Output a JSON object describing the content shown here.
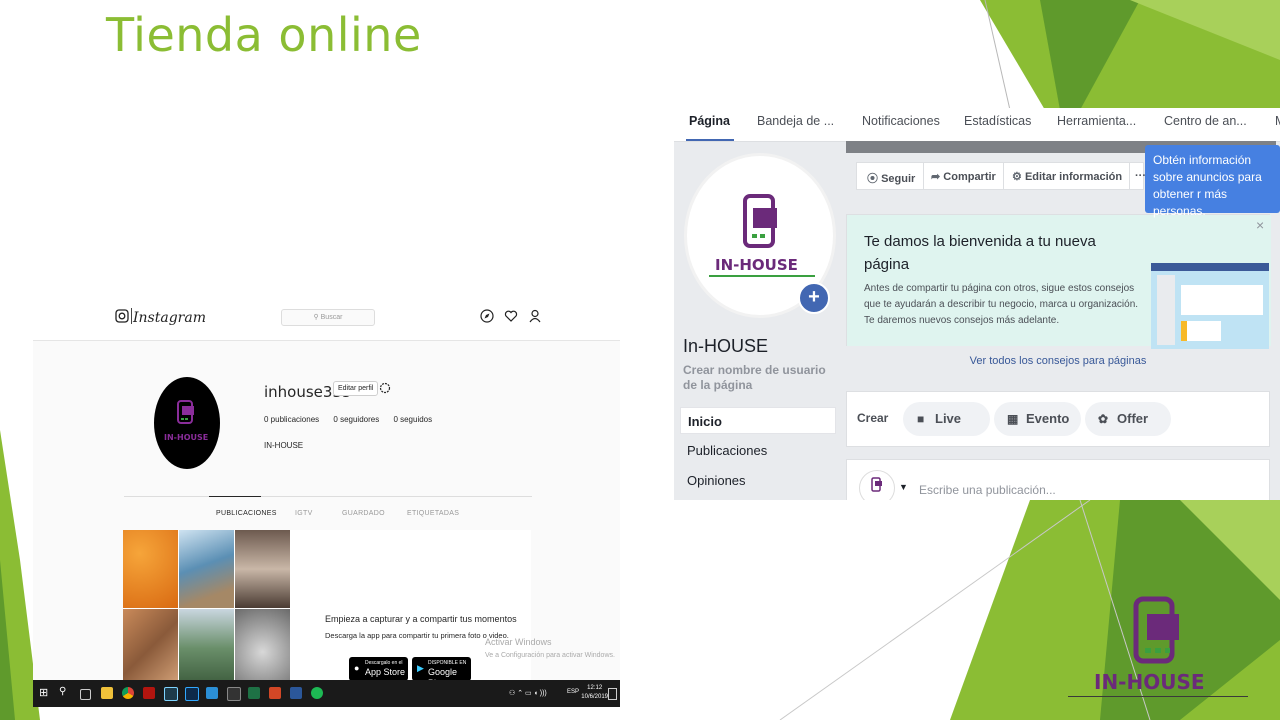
{
  "slide": {
    "title": "Tienda online"
  },
  "instagram": {
    "wordmark": "Instagram",
    "search_placeholder": "Buscar",
    "username": "inhouse335",
    "edit_profile": "Editar perfil",
    "stats": [
      "0 publicaciones",
      "0 seguidores",
      "0 seguidos"
    ],
    "full_name": "IN-HOUSE",
    "tabs": [
      "PUBLICACIONES",
      "IGTV",
      "GUARDADO",
      "ETIQUETADAS"
    ],
    "cta_title": "Empieza a capturar y a compartir tus momentos",
    "cta_desc": "Descarga la app para compartir tu primera foto o video.",
    "app_store": {
      "small": "Descargalo en el",
      "label": "App Store"
    },
    "google_play": {
      "small": "DISPONIBLE EN",
      "label": "Google Play"
    },
    "windows_watermark": {
      "title": "Activar Windows",
      "sub": "Ve a Configuración para activar Windows."
    },
    "taskbar": {
      "lang": "ESP",
      "time": "12:12",
      "date": "10/6/2019"
    }
  },
  "facebook": {
    "tabs": [
      "Página",
      "Bandeja de ...",
      "Notificaciones",
      "Estadísticas",
      "Herramienta...",
      "Centro de an...",
      "M"
    ],
    "actions": {
      "follow": "Seguir",
      "share": "Compartir",
      "edit": "Editar información",
      "more": "···"
    },
    "tooltip": "Obtén información sobre anuncios para obtener r más personas.",
    "page_name": "In-HOUSE",
    "create_username": "Crear nombre de usuario de la página",
    "sidebar": [
      "Inicio",
      "Publicaciones",
      "Opiniones"
    ],
    "welcome": {
      "title": "Te damos la bienvenida a tu nueva página",
      "text": "Antes de compartir tu página con otros, sigue estos consejos que te ayudarán a describir tu negocio, marca u organización. Te daremos nuevos consejos más adelante.",
      "link": "Ver todos los consejos para páginas",
      "close": "×"
    },
    "create": {
      "label": "Crear",
      "buttons": [
        "Live",
        "Evento",
        "Offer"
      ]
    },
    "compose_placeholder": "Escribe una publicación...",
    "add_photo": "+"
  },
  "brand": {
    "logo_text": "IN-HOUSE"
  },
  "colors": {
    "title_green": "#8bbd34",
    "purple": "#6b2a7a",
    "fb_blue": "#4267b2",
    "logo_green": "#2e7a33"
  },
  "icons": [
    "instagram-icon",
    "compass-icon",
    "heart-icon",
    "user-icon",
    "settings-icon",
    "rss-icon",
    "share-arrow-icon",
    "gear-icon",
    "close-icon",
    "video-icon",
    "calendar-icon",
    "offer-icon",
    "caret-down-icon",
    "windows-start-icon",
    "search-icon"
  ]
}
